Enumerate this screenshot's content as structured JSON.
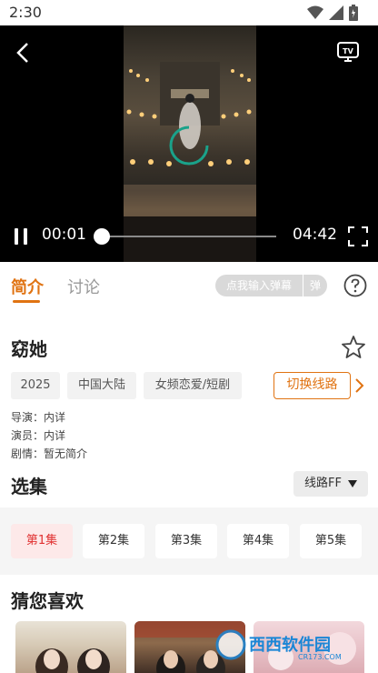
{
  "status_bar": {
    "time": "2:30"
  },
  "player": {
    "current_time": "00:01",
    "total_time": "04:42",
    "progress": 0.0
  },
  "tabs": {
    "intro": "简介",
    "discuss": "讨论",
    "danmu_placeholder": "点我输入弹幕",
    "danmu_button": "弹"
  },
  "info": {
    "title": "窈她",
    "tags": [
      "2025",
      "中国大陆",
      "女频恋爱/短剧"
    ],
    "switch_route": "切换线路",
    "director": "导演：内详",
    "actors": "演员：内详",
    "plot": "剧情：暂无简介"
  },
  "episodes": {
    "title": "选集",
    "route_label": "线路FF",
    "items": [
      "第1集",
      "第2集",
      "第3集",
      "第4集",
      "第5集"
    ],
    "active_index": 0
  },
  "recommend": {
    "title": "猜您喜欢"
  },
  "watermark": {
    "text": "西西软件园",
    "sub": "CR173.COM"
  },
  "colors": {
    "accent": "#e07312",
    "active_episode": "#e03030"
  }
}
